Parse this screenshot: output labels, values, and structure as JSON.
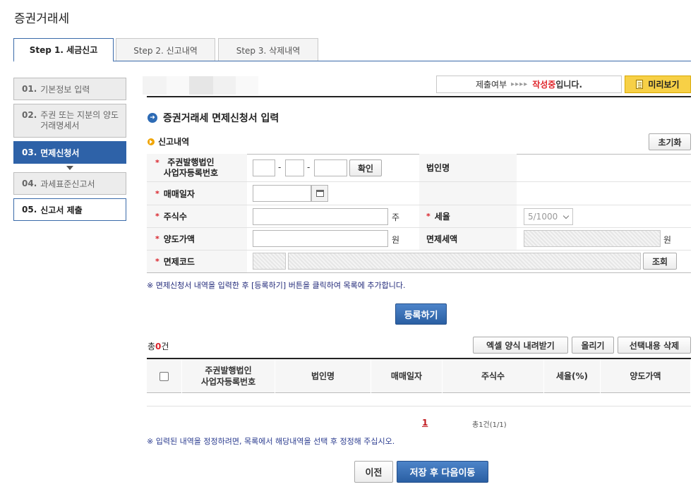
{
  "page": {
    "title": "증권거래세"
  },
  "tabs": [
    {
      "label": "Step 1. 세금신고"
    },
    {
      "label": "Step 2. 신고내역"
    },
    {
      "label": "Step 3. 삭제내역"
    }
  ],
  "steps": [
    {
      "num": "01.",
      "label": "기본정보 입력"
    },
    {
      "num": "02.",
      "label": "주권 또는 지분의 양도거래명세서"
    },
    {
      "num": "03.",
      "label": "면제신청서"
    },
    {
      "num": "04.",
      "label": "과세표준신고서"
    },
    {
      "num": "05.",
      "label": "신고서 제출"
    }
  ],
  "status": {
    "label": "제출여부",
    "arrows": "▸▸▸▸",
    "state": "작성중",
    "suffix": "입니다."
  },
  "preview_button": "미리보기",
  "section": {
    "title": "증권거래세 면제신청서 입력",
    "subtitle": "신고내역",
    "reset_button": "초기화"
  },
  "form": {
    "bizno_label_1": "주권발행법인",
    "bizno_label_2": "사업자등록번호",
    "dash": "-",
    "confirm_button": "확인",
    "corp_name_label": "법인명",
    "trade_date_label": "매매일자",
    "shares_label": "주식수",
    "shares_unit": "주",
    "tax_rate_label": "세율",
    "tax_rate_value": "5/1000",
    "transfer_amount_label": "양도가액",
    "won_unit": "원",
    "exempt_tax_label": "면제세액",
    "exempt_code_label": "면제코드",
    "lookup_button": "조회",
    "required_mark": "*"
  },
  "notes": {
    "register_hint": "※ 면제신청서 내역을 입력한 후 [등록하기] 버튼을 클릭하여 목록에 추가합니다.",
    "edit_hint": "※ 입력된 내역을 정정하려면, 목록에서 해당내역을 선택 후 정정해 주십시오."
  },
  "register_button": "등록하기",
  "list": {
    "total_prefix": "총",
    "total_count": "0",
    "total_suffix": "건",
    "excel_button": "엑셀 양식 내려받기",
    "upload_button": "올리기",
    "delete_button": "선택내용 삭제",
    "headers": [
      "주권발행법인 사업자등록번호",
      "법인명",
      "매매일자",
      "주식수",
      "세율(%)",
      "양도가액"
    ],
    "headers_split": {
      "h0a": "주권발행법인",
      "h0b": "사업자등록번호"
    }
  },
  "pagination": {
    "current": "1",
    "info": "총1건(1/1)"
  },
  "footer": {
    "prev_button": "이전",
    "next_button": "저장 후 다음이동"
  },
  "colors": {
    "accent": "#2e62a8",
    "highlight": "#f7d046",
    "required": "#d9222a"
  }
}
